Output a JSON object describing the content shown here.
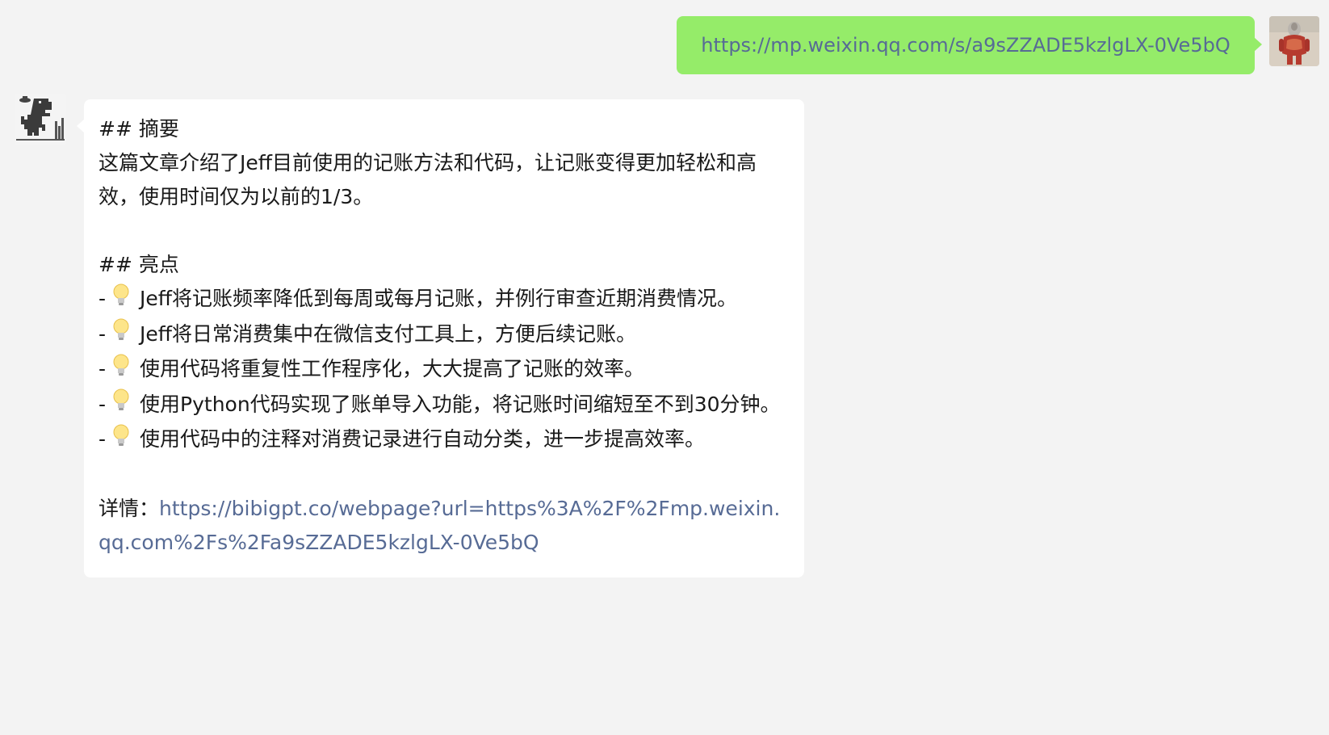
{
  "outgoing": {
    "url_text": "https://mp.weixin.qq.com/s/a9sZZADE5kzlgLX-0Ve5bQ"
  },
  "incoming": {
    "summary_heading": "## 摘要",
    "summary_text": "这篇文章介绍了Jeff目前使用的记账方法和代码，让记账变得更加轻松和高效，使用时间仅为以前的1/3。",
    "highlights_heading": "## 亮点",
    "bullet_prefix": "-",
    "highlights": [
      "Jeff将记账频率降低到每周或每月记账，并例行审查近期消费情况。",
      "Jeff将日常消费集中在微信支付工具上，方便后续记账。",
      "使用代码将重复性工作程序化，大大提高了记账的效率。",
      "使用Python代码实现了账单导入功能，将记账时间缩短至不到30分钟。",
      "使用代码中的注释对消费记录进行自动分类，进一步提高效率。"
    ],
    "details_label": "详情：",
    "details_link": "https://bibigpt.co/webpage?url=https%3A%2F%2Fmp.weixin.qq.com%2Fs%2Fa9sZZADE5kzlgLX-0Ve5bQ"
  },
  "icons": {
    "bullet_icon": "lightbulb-icon",
    "self_avatar": "avatar-figure",
    "bot_avatar": "dinosaur-avatar"
  }
}
